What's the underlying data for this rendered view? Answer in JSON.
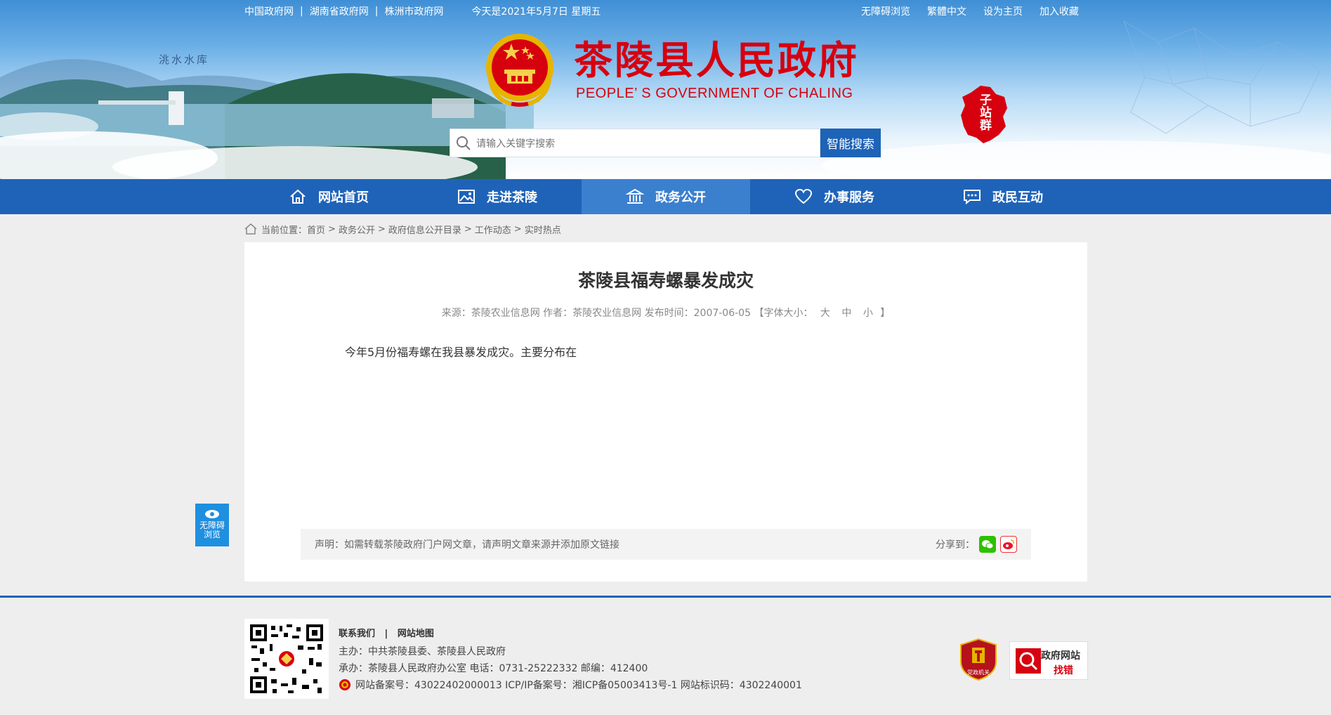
{
  "topbar": {
    "links": [
      "中国政府网",
      "湖南省政府网",
      "株洲市政府网"
    ],
    "date": "今天是2021年5月7日 星期五",
    "right_links": [
      "无障碍浏览",
      "繁體中文",
      "设为主页",
      "加入收藏"
    ]
  },
  "banner": {
    "reservoir_label": "洮水水库",
    "title": "茶陵县人民政府",
    "title_en": "PEOPLE’ S GOVERNMENT OF CHALING",
    "sub_station": [
      "子",
      "站",
      "群"
    ]
  },
  "search": {
    "placeholder": "请输入关键字搜索",
    "button": "智能搜索"
  },
  "nav": [
    {
      "label": "网站首页",
      "icon": "home-icon"
    },
    {
      "label": "走进茶陵",
      "icon": "picture-icon"
    },
    {
      "label": "政务公开",
      "icon": "building-icon",
      "active": true
    },
    {
      "label": "办事服务",
      "icon": "heart-icon"
    },
    {
      "label": "政民互动",
      "icon": "chat-icon"
    }
  ],
  "breadcrumb": {
    "prefix": "当前位置：",
    "items": [
      "首页",
      "政务公开",
      "政府信息公开目录",
      "工作动态",
      "实时热点"
    ]
  },
  "article": {
    "title": "茶陵县福寿螺暴发成灾",
    "source_label": "来源：",
    "source": "茶陵农业信息网",
    "author_label": "作者：",
    "author": "茶陵农业信息网",
    "date_label": "发布时间：",
    "date": "2007-06-05",
    "font_size_label": "【字体大小：",
    "font_sizes": [
      "大",
      "中",
      "小"
    ],
    "font_size_end": "】",
    "body": "今年5月份福寿螺在我县暴发成灾。主要分布在"
  },
  "notice": {
    "text": "声明：如需转载茶陵政府门户网文章，请声明文章来源并添加原文链接",
    "share_label": "分享到："
  },
  "accessibility": {
    "line1": "无障碍",
    "line2": "浏览"
  },
  "footer": {
    "links": [
      "联系我们",
      "网站地图"
    ],
    "host": "主办：中共茶陵县委、茶陵县人民政府",
    "organizer": "承办：茶陵县人民政府办公室 电话：0731-25222332 邮编：412400",
    "record": "网站备案号：43022402000013 ICP/IP备案号：湘ICP备05003413号-1 网站标识码：4302240001",
    "badge1_text": "党政机关",
    "badge2_line1": "政府网站",
    "badge2_line2": "找错"
  },
  "colors": {
    "nav": "#1f63b8",
    "nav_active": "#3b80cf",
    "title_red": "#d7000f",
    "search_button": "#1d63b7"
  }
}
